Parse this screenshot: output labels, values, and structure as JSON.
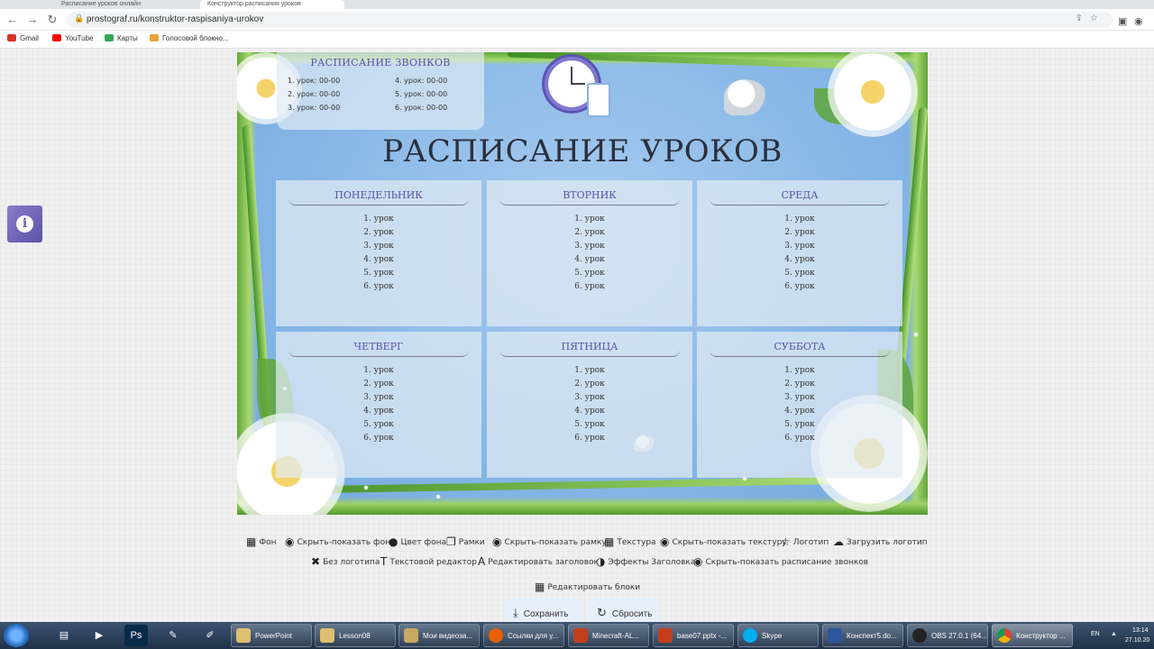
{
  "browser": {
    "tabs": [
      "Расписание уроков онлайн",
      "Конструктор расписания уроков"
    ],
    "url": "prostograf.ru/konstruktor-raspisaniya-urokov",
    "bookmarks": [
      "Gmail",
      "YouTube",
      "Карты",
      "Голосовой блокно..."
    ]
  },
  "poster": {
    "bells_title": "РАСПИСАНИЕ ЗВОНКОВ",
    "bells": [
      "1. урок: 00-00",
      "2. урок: 00-00",
      "3. урок: 00-00",
      "4. урок: 00-00",
      "5. урок: 00-00",
      "6. урок: 00-00"
    ],
    "title": "РАСПИСАНИЕ УРОКОВ",
    "days": [
      {
        "name": "ПОНЕДЕЛЬНИК",
        "lessons": [
          "1. урок",
          "2. урок",
          "3. урок",
          "4. урок",
          "5. урок",
          "6. урок"
        ]
      },
      {
        "name": "ВТОРНИК",
        "lessons": [
          "1. урок",
          "2. урок",
          "3. урок",
          "4. урок",
          "5. урок",
          "6. урок"
        ]
      },
      {
        "name": "СРЕДА",
        "lessons": [
          "1. урок",
          "2. урок",
          "3. урок",
          "4. урок",
          "5. урок",
          "6. урок"
        ]
      },
      {
        "name": "ЧЕТВЕРГ",
        "lessons": [
          "1. урок",
          "2. урок",
          "3. урок",
          "4. урок",
          "5. урок",
          "6. урок"
        ]
      },
      {
        "name": "ПЯТНИЦА",
        "lessons": [
          "1. урок",
          "2. урок",
          "3. урок",
          "4. урок",
          "5. урок",
          "6. урок"
        ]
      },
      {
        "name": "СУББОТА",
        "lessons": [
          "1. урок",
          "2. урок",
          "3. урок",
          "4. урок",
          "5. урок",
          "6. урок"
        ]
      }
    ]
  },
  "tools": {
    "row1": [
      "Фон",
      "Скрыть-показать фон",
      "Цвет фона",
      "Рамки",
      "Скрыть-показать рамку",
      "Текстура",
      "Скрыть-показать текстуру",
      "Логотип",
      "Загрузить логотип"
    ],
    "row2": [
      "Без логотипа",
      "Текстовой редактор",
      "Редактировать заголовок",
      "Эффекты Заголовка",
      "Скрыть-показать расписание звонков"
    ],
    "edit_blocks": "Редактировать блоки",
    "save": "Сохранить",
    "reset": "Сбросить"
  },
  "taskbar": {
    "items": [
      "PowerPoint",
      "Lesson08",
      "Мои видеоза...",
      "Ссылки для у...",
      "Minecraft-AL...",
      "base07.pptx -...",
      "Skype",
      "Конспект5.do...",
      "OBS 27.0.1 (64...",
      "Конструктор ..."
    ],
    "lang": "EN",
    "time": "13:14",
    "date": "27.10.20"
  },
  "colors": {
    "accent_title": "#5a50a8",
    "poster_sky": "#86b6e6",
    "taskbar": "#2a3f5a"
  }
}
